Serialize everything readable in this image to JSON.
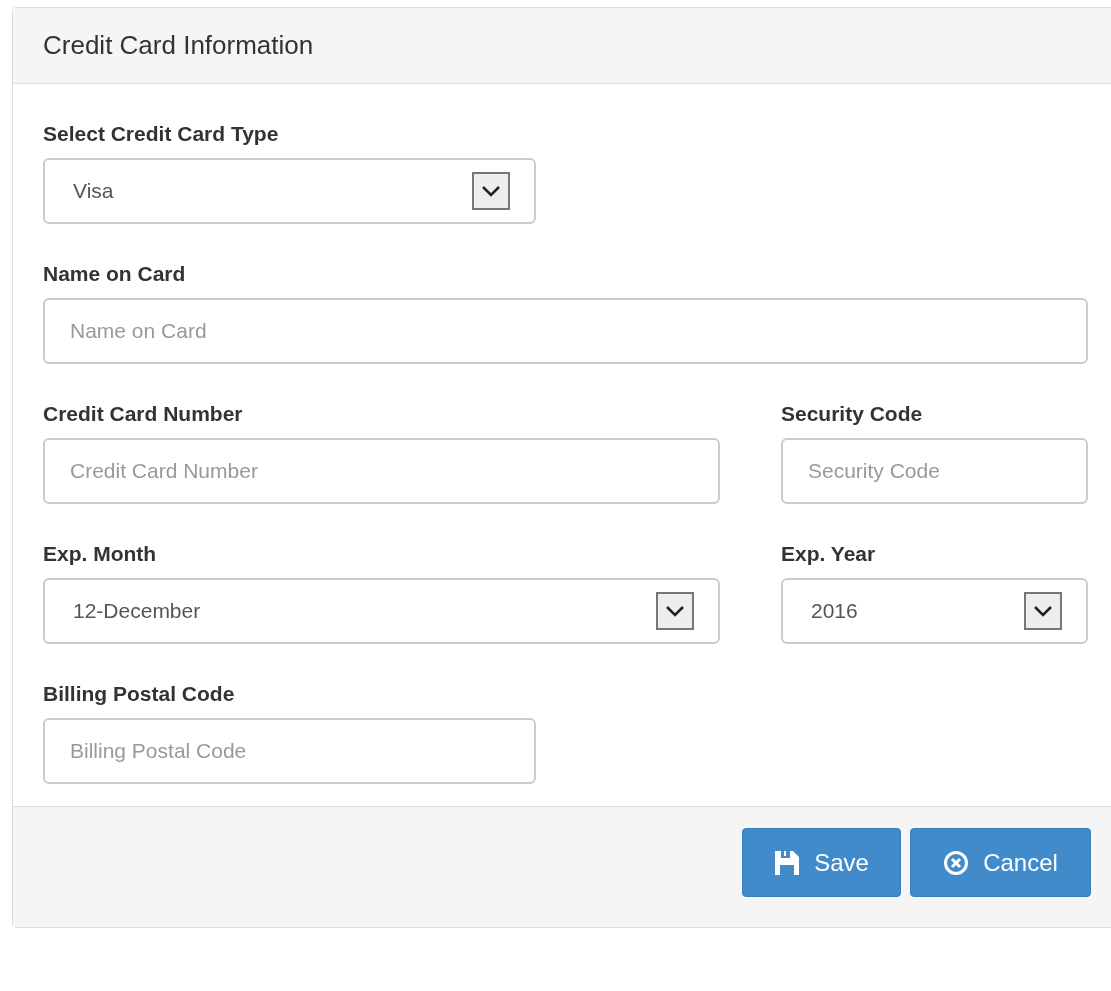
{
  "panel": {
    "title": "Credit Card Information"
  },
  "rows": [
    {
      "fields": [
        {
          "label": "Select Credit Card Type",
          "kind": "select",
          "value": "Visa"
        }
      ]
    },
    {
      "fields": [
        {
          "label": "Name on Card",
          "kind": "text",
          "placeholder": "Name on Card"
        }
      ]
    },
    {
      "fields": [
        {
          "label": "Credit Card Number",
          "kind": "text",
          "placeholder": "Credit Card Number"
        },
        {
          "label": "Security Code",
          "kind": "text",
          "placeholder": "Security Code"
        }
      ]
    },
    {
      "fields": [
        {
          "label": "Exp. Month",
          "kind": "select",
          "value": "12-December"
        },
        {
          "label": "Exp. Year",
          "kind": "select",
          "value": "2016"
        }
      ]
    },
    {
      "fields": [
        {
          "label": "Billing Postal Code",
          "kind": "text",
          "placeholder": "Billing Postal Code"
        }
      ]
    }
  ],
  "buttons": [
    {
      "label": "Save",
      "kind": "save"
    },
    {
      "label": "Cancel",
      "kind": "cancel"
    }
  ]
}
